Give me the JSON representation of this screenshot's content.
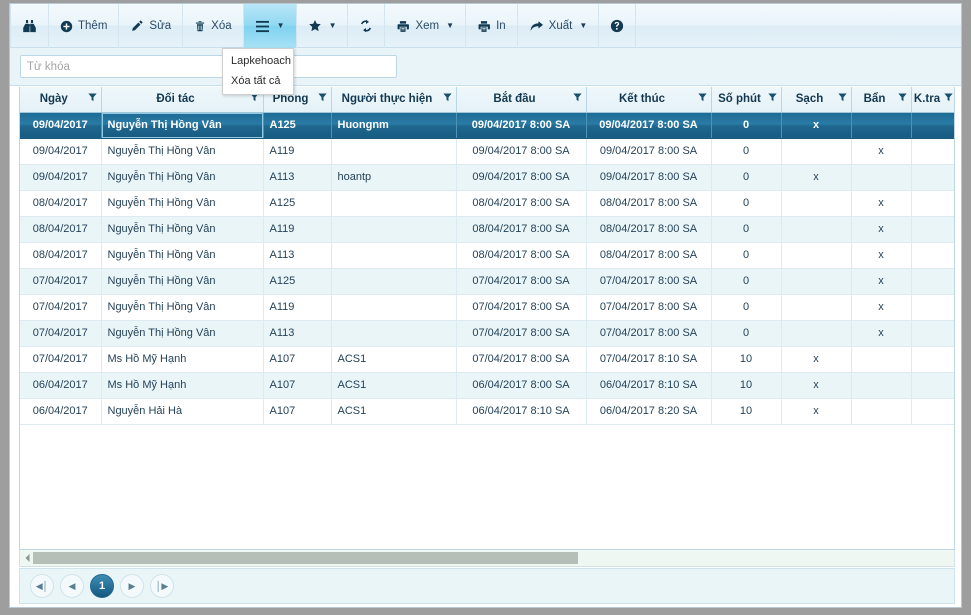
{
  "toolbar": {
    "buttons": [
      {
        "name": "find",
        "icon": "binoculars-icon",
        "label": "",
        "caret": false,
        "active": false
      },
      {
        "name": "add",
        "icon": "plus-circle-icon",
        "label": "Thêm",
        "caret": false,
        "active": false
      },
      {
        "name": "edit",
        "icon": "pencil-icon",
        "label": "Sửa",
        "caret": false,
        "active": false
      },
      {
        "name": "delete",
        "icon": "trash-icon",
        "label": "Xóa",
        "caret": false,
        "active": false
      },
      {
        "name": "menu",
        "icon": "hamburger-icon",
        "label": "",
        "caret": true,
        "active": true
      },
      {
        "name": "favorite",
        "icon": "star-icon",
        "label": "",
        "caret": true,
        "active": false
      },
      {
        "name": "refresh",
        "icon": "refresh-icon",
        "label": "",
        "caret": false,
        "active": false
      },
      {
        "name": "preview",
        "icon": "printer-icon",
        "label": "Xem",
        "caret": true,
        "active": false
      },
      {
        "name": "print",
        "icon": "printer-icon",
        "label": "In",
        "caret": false,
        "active": false
      },
      {
        "name": "export",
        "icon": "share-arrow-icon",
        "label": "Xuất",
        "caret": true,
        "active": false
      },
      {
        "name": "help",
        "icon": "question-circle-icon",
        "label": "",
        "caret": false,
        "active": false
      }
    ]
  },
  "context_menu": {
    "items": [
      {
        "label": "Lapkehoach"
      },
      {
        "label": "Xóa tất cả"
      }
    ]
  },
  "search": {
    "placeholder": "Từ khóa",
    "value": ""
  },
  "grid": {
    "columns": [
      {
        "key": "ngay",
        "label": "Ngày",
        "align": "center"
      },
      {
        "key": "doitac",
        "label": "Đối tác",
        "align": "left"
      },
      {
        "key": "phong",
        "label": "Phòng",
        "align": "left"
      },
      {
        "key": "nguoi",
        "label": "Người thực hiện",
        "align": "left"
      },
      {
        "key": "batdau",
        "label": "Bắt đầu",
        "align": "center"
      },
      {
        "key": "ketthuc",
        "label": "Kết thúc",
        "align": "center"
      },
      {
        "key": "sophut",
        "label": "Số phút",
        "align": "center"
      },
      {
        "key": "sach",
        "label": "Sạch",
        "align": "center"
      },
      {
        "key": "ban",
        "label": "Bẩn",
        "align": "center"
      },
      {
        "key": "ktra",
        "label": "K.tra",
        "align": "center"
      }
    ],
    "rows": [
      {
        "ngay": "09/04/2017",
        "doitac": "Nguyễn Thị Hồng Vân",
        "phong": "A125",
        "nguoi": "Huongnm",
        "batdau": "09/04/2017 8:00 SA",
        "ketthuc": "09/04/2017 8:00 SA",
        "sophut": "0",
        "sach": "x",
        "ban": "",
        "ktra": "",
        "selected": true
      },
      {
        "ngay": "09/04/2017",
        "doitac": "Nguyễn Thị Hồng Vân",
        "phong": "A119",
        "nguoi": "",
        "batdau": "09/04/2017 8:00 SA",
        "ketthuc": "09/04/2017 8:00 SA",
        "sophut": "0",
        "sach": "",
        "ban": "x",
        "ktra": "",
        "selected": false
      },
      {
        "ngay": "09/04/2017",
        "doitac": "Nguyễn Thị Hồng Vân",
        "phong": "A113",
        "nguoi": "hoantp",
        "batdau": "09/04/2017 8:00 SA",
        "ketthuc": "09/04/2017 8:00 SA",
        "sophut": "0",
        "sach": "x",
        "ban": "",
        "ktra": "",
        "selected": false
      },
      {
        "ngay": "08/04/2017",
        "doitac": "Nguyễn Thị Hồng Vân",
        "phong": "A125",
        "nguoi": "",
        "batdau": "08/04/2017 8:00 SA",
        "ketthuc": "08/04/2017 8:00 SA",
        "sophut": "0",
        "sach": "",
        "ban": "x",
        "ktra": "",
        "selected": false
      },
      {
        "ngay": "08/04/2017",
        "doitac": "Nguyễn Thị Hồng Vân",
        "phong": "A119",
        "nguoi": "",
        "batdau": "08/04/2017 8:00 SA",
        "ketthuc": "08/04/2017 8:00 SA",
        "sophut": "0",
        "sach": "",
        "ban": "x",
        "ktra": "",
        "selected": false
      },
      {
        "ngay": "08/04/2017",
        "doitac": "Nguyễn Thị Hồng Vân",
        "phong": "A113",
        "nguoi": "",
        "batdau": "08/04/2017 8:00 SA",
        "ketthuc": "08/04/2017 8:00 SA",
        "sophut": "0",
        "sach": "",
        "ban": "x",
        "ktra": "",
        "selected": false
      },
      {
        "ngay": "07/04/2017",
        "doitac": "Nguyễn Thị Hồng Vân",
        "phong": "A125",
        "nguoi": "",
        "batdau": "07/04/2017 8:00 SA",
        "ketthuc": "07/04/2017 8:00 SA",
        "sophut": "0",
        "sach": "",
        "ban": "x",
        "ktra": "",
        "selected": false
      },
      {
        "ngay": "07/04/2017",
        "doitac": "Nguyễn Thị Hồng Vân",
        "phong": "A119",
        "nguoi": "",
        "batdau": "07/04/2017 8:00 SA",
        "ketthuc": "07/04/2017 8:00 SA",
        "sophut": "0",
        "sach": "",
        "ban": "x",
        "ktra": "",
        "selected": false
      },
      {
        "ngay": "07/04/2017",
        "doitac": "Nguyễn Thị Hồng Vân",
        "phong": "A113",
        "nguoi": "",
        "batdau": "07/04/2017 8:00 SA",
        "ketthuc": "07/04/2017 8:00 SA",
        "sophut": "0",
        "sach": "",
        "ban": "x",
        "ktra": "",
        "selected": false
      },
      {
        "ngay": "07/04/2017",
        "doitac": "Ms Hồ Mỹ Hạnh",
        "phong": "A107",
        "nguoi": "ACS1",
        "batdau": "07/04/2017 8:00 SA",
        "ketthuc": "07/04/2017 8:10 SA",
        "sophut": "10",
        "sach": "x",
        "ban": "",
        "ktra": "",
        "selected": false
      },
      {
        "ngay": "06/04/2017",
        "doitac": "Ms Hồ Mỹ Hạnh",
        "phong": "A107",
        "nguoi": "ACS1",
        "batdau": "06/04/2017 8:00 SA",
        "ketthuc": "06/04/2017 8:10 SA",
        "sophut": "10",
        "sach": "x",
        "ban": "",
        "ktra": "",
        "selected": false
      },
      {
        "ngay": "06/04/2017",
        "doitac": "Nguyễn Hải Hà",
        "phong": "A107",
        "nguoi": "ACS1",
        "batdau": "06/04/2017 8:10 SA",
        "ketthuc": "06/04/2017 8:20 SA",
        "sophut": "10",
        "sach": "x",
        "ban": "",
        "ktra": "",
        "selected": false
      }
    ]
  },
  "pager": {
    "buttons": [
      {
        "name": "first",
        "glyph": "◀│",
        "current": false
      },
      {
        "name": "prev",
        "glyph": "◀",
        "current": false
      },
      {
        "name": "page-1",
        "glyph": "1",
        "current": true
      },
      {
        "name": "next",
        "glyph": "▶",
        "current": false
      },
      {
        "name": "last",
        "glyph": "│▶",
        "current": false
      }
    ]
  },
  "colors": {
    "accent": "#1d6b94",
    "toolbar_active": "#8fd8f2",
    "header_text": "#14384f",
    "alt_row": "#eaf5f8",
    "scroll_thumb": "#b6bfb7"
  }
}
